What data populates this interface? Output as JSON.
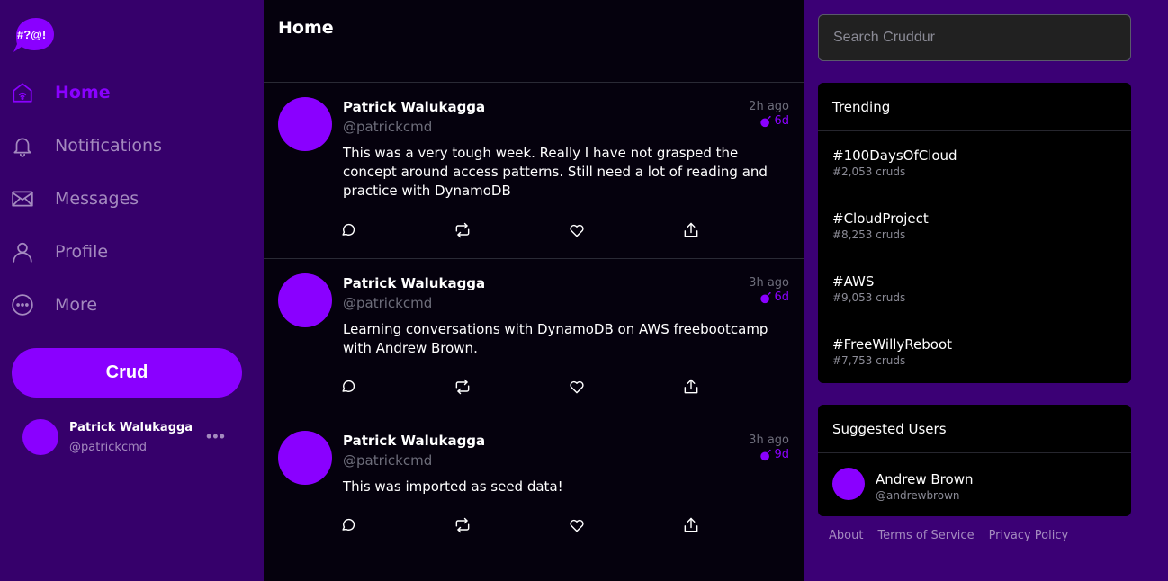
{
  "app": {
    "logo_text": "#?@!",
    "brand_color": "#8a00ff",
    "sidebar_bg": "#36006b",
    "page_bg": "#3b0075"
  },
  "nav": {
    "items": [
      {
        "label": "Home",
        "icon": "home-icon",
        "active": true
      },
      {
        "label": "Notifications",
        "icon": "bell-icon",
        "active": false
      },
      {
        "label": "Messages",
        "icon": "envelope-icon",
        "active": false
      },
      {
        "label": "Profile",
        "icon": "user-icon",
        "active": false
      },
      {
        "label": "More",
        "icon": "more-circle-icon",
        "active": false
      }
    ],
    "crud_button_label": "Crud"
  },
  "profile": {
    "name": "Patrick Walukagga",
    "handle": "@patrickcmd",
    "menu_label": "•••"
  },
  "feed": {
    "title": "Home",
    "cruds": [
      {
        "name": "Patrick Walukagga",
        "handle": "@patrickcmd",
        "time_ago": "2h ago",
        "expires": "6d",
        "message": "This was a very tough week. Really I have not grasped the concept around access patterns. Still need a lot of reading and practice with DynamoDB"
      },
      {
        "name": "Patrick Walukagga",
        "handle": "@patrickcmd",
        "time_ago": "3h ago",
        "expires": "6d",
        "message": "Learning conversations with DynamoDB on AWS freebootcamp with Andrew Brown."
      },
      {
        "name": "Patrick Walukagga",
        "handle": "@patrickcmd",
        "time_ago": "3h ago",
        "expires": "9d",
        "message": "This was imported as seed data!"
      }
    ],
    "action_icons": [
      "reply-icon",
      "repost-icon",
      "like-icon",
      "share-icon"
    ]
  },
  "search": {
    "placeholder": "Search Cruddur"
  },
  "trending": {
    "title": "Trending",
    "items": [
      {
        "name": "#100DaysOfCloud",
        "count": "#2,053 cruds"
      },
      {
        "name": "#CloudProject",
        "count": "#8,253 cruds"
      },
      {
        "name": "#AWS",
        "count": "#9,053 cruds"
      },
      {
        "name": "#FreeWillyReboot",
        "count": "#7,753 cruds"
      }
    ]
  },
  "suggested": {
    "title": "Suggested Users",
    "users": [
      {
        "name": "Andrew Brown",
        "handle": "@andrewbrown"
      }
    ]
  },
  "footer": {
    "links": [
      "About",
      "Terms of Service",
      "Privacy Policy"
    ]
  }
}
